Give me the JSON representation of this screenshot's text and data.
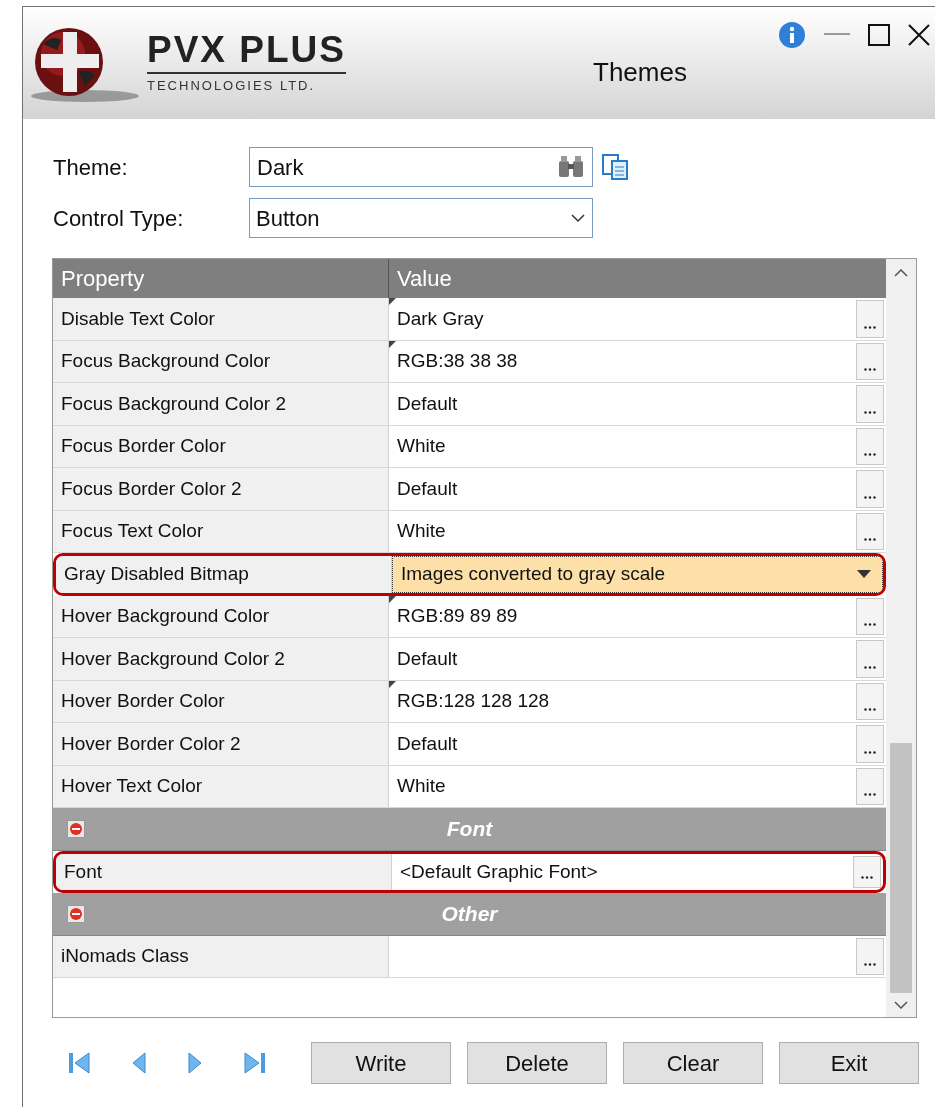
{
  "window": {
    "title": "Themes",
    "logo": {
      "name": "PVX PLUS",
      "subtitle": "TECHNOLOGIES LTD."
    }
  },
  "form": {
    "theme": {
      "label": "Theme:",
      "value": "Dark"
    },
    "control_type": {
      "label": "Control Type:",
      "value": "Button"
    }
  },
  "grid": {
    "columns": [
      "Property",
      "Value"
    ],
    "rows": [
      {
        "kind": "ellipsis",
        "name": "Disable Text Color",
        "value": "Dark Gray",
        "modified": true,
        "selected": false,
        "highlighted": false
      },
      {
        "kind": "ellipsis",
        "name": "Focus Background Color",
        "value": "RGB:38 38 38",
        "modified": true,
        "selected": false,
        "highlighted": false
      },
      {
        "kind": "ellipsis",
        "name": "Focus Background Color 2",
        "value": "Default",
        "modified": false,
        "selected": false,
        "highlighted": false
      },
      {
        "kind": "ellipsis",
        "name": "Focus Border Color",
        "value": "White",
        "modified": false,
        "selected": false,
        "highlighted": false
      },
      {
        "kind": "ellipsis",
        "name": "Focus Border Color 2",
        "value": "Default",
        "modified": false,
        "selected": false,
        "highlighted": false
      },
      {
        "kind": "ellipsis",
        "name": "Focus Text Color",
        "value": "White",
        "modified": false,
        "selected": false,
        "highlighted": false
      },
      {
        "kind": "dropdown",
        "name": "Gray Disabled Bitmap",
        "value": "Images converted to gray scale",
        "modified": false,
        "selected": true,
        "highlighted": true
      },
      {
        "kind": "ellipsis",
        "name": "Hover Background Color",
        "value": "RGB:89 89 89",
        "modified": true,
        "selected": false,
        "highlighted": false
      },
      {
        "kind": "ellipsis",
        "name": "Hover Background Color 2",
        "value": "Default",
        "modified": false,
        "selected": false,
        "highlighted": false
      },
      {
        "kind": "ellipsis",
        "name": "Hover Border Color",
        "value": "RGB:128 128 128",
        "modified": true,
        "selected": false,
        "highlighted": false
      },
      {
        "kind": "ellipsis",
        "name": "Hover Border Color 2",
        "value": "Default",
        "modified": false,
        "selected": false,
        "highlighted": false
      },
      {
        "kind": "ellipsis",
        "name": "Hover Text Color",
        "value": "White",
        "modified": false,
        "selected": false,
        "highlighted": false
      },
      {
        "kind": "section",
        "name": "Font",
        "expanded": true
      },
      {
        "kind": "ellipsis",
        "name": "Font",
        "value": "<Default Graphic Font>",
        "modified": false,
        "selected": false,
        "highlighted": true
      },
      {
        "kind": "section",
        "name": "Other",
        "expanded": true
      },
      {
        "kind": "ellipsis",
        "name": "iNomads Class",
        "modified": false,
        "selected": false,
        "highlighted": false
      }
    ]
  },
  "buttons": [
    {
      "label": "Write"
    },
    {
      "label": "Delete"
    },
    {
      "label": "Clear"
    },
    {
      "label": "Exit"
    }
  ]
}
